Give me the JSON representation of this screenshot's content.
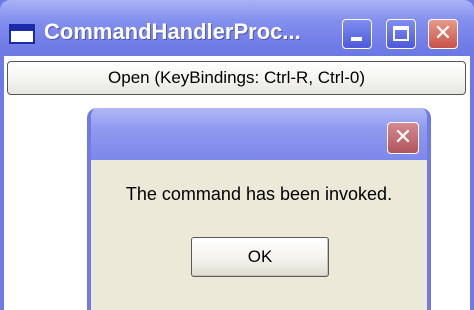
{
  "main_window": {
    "title": "CommandHandlerProc...",
    "icon": "window-icon",
    "controls": {
      "minimize": "minimize-icon",
      "maximize": "maximize-icon",
      "close": "close-icon"
    }
  },
  "open_button": {
    "label": "Open (KeyBindings: Ctrl-R, Ctrl-0)"
  },
  "message_box": {
    "message": "The command has been invoked.",
    "ok_label": "OK",
    "close_icon": "close-icon"
  },
  "colors": {
    "titlebar_blue": "#7480e8",
    "close_red": "#c9524a",
    "dialog_face": "#ece9d8"
  }
}
